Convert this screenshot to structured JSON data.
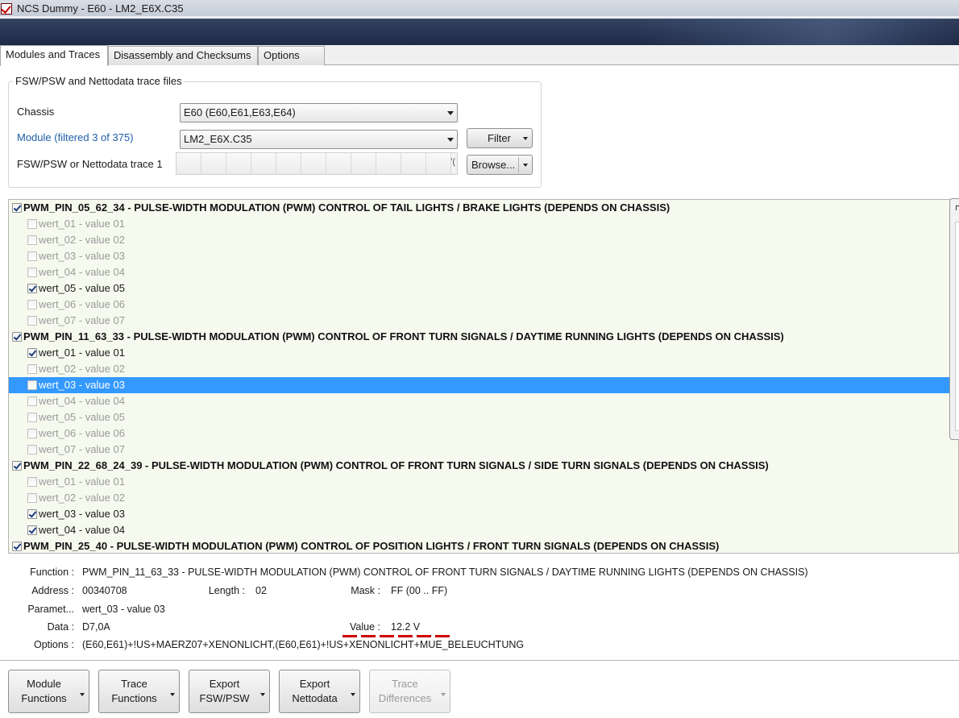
{
  "window": {
    "title": "NCS Dummy - E60 - LM2_E6X.C35"
  },
  "tabs": [
    {
      "label": "Modules and Traces",
      "active": true
    },
    {
      "label": "Disassembly and Checksums",
      "active": false
    },
    {
      "label": "Options",
      "active": false
    }
  ],
  "files": {
    "group_title": "FSW/PSW and Nettodata trace files",
    "chassis_label": "Chassis",
    "chassis_value": "E60  (E60,E61,E63,E64)",
    "module_label": "Module (filtered 3 of 375)",
    "module_value": "LM2_E6X.C35",
    "filter_button": "Filter",
    "trace_label": "FSW/PSW or Nettodata trace 1",
    "browse_button": "Browse...",
    "trace_tail_text": "'("
  },
  "tree": {
    "groups": [
      {
        "name": "PWM_PIN_05_62_34  -  PULSE-WIDTH MODULATION (PWM) CONTROL OF TAIL LIGHTS / BRAKE LIGHTS (DEPENDS ON CHASSIS)",
        "checked": true,
        "items": [
          {
            "label": "wert_01  -  value 01",
            "checked": false
          },
          {
            "label": "wert_02  -  value 02",
            "checked": false
          },
          {
            "label": "wert_03  -  value 03",
            "checked": false
          },
          {
            "label": "wert_04  -  value 04",
            "checked": false
          },
          {
            "label": "wert_05  -  value 05",
            "checked": true
          },
          {
            "label": "wert_06  -  value 06",
            "checked": false
          },
          {
            "label": "wert_07  -  value 07",
            "checked": false
          }
        ]
      },
      {
        "name": "PWM_PIN_11_63_33  -  PULSE-WIDTH MODULATION (PWM) CONTROL OF FRONT TURN SIGNALS / DAYTIME RUNNING LIGHTS (DEPENDS ON CHASSIS)",
        "checked": true,
        "items": [
          {
            "label": "wert_01  -  value 01",
            "checked": true
          },
          {
            "label": "wert_02  -  value 02",
            "checked": false
          },
          {
            "label": "wert_03  -  value 03",
            "checked": false,
            "selected": true
          },
          {
            "label": "wert_04  -  value 04",
            "checked": false
          },
          {
            "label": "wert_05  -  value 05",
            "checked": false
          },
          {
            "label": "wert_06  -  value 06",
            "checked": false
          },
          {
            "label": "wert_07  -  value 07",
            "checked": false
          }
        ]
      },
      {
        "name": "PWM_PIN_22_68_24_39  -  PULSE-WIDTH MODULATION (PWM) CONTROL OF FRONT TURN SIGNALS / SIDE TURN SIGNALS (DEPENDS ON CHASSIS)",
        "checked": true,
        "items": [
          {
            "label": "wert_01  -  value 01",
            "checked": false
          },
          {
            "label": "wert_02  -  value 02",
            "checked": false
          },
          {
            "label": "wert_03  -  value 03",
            "checked": true
          },
          {
            "label": "wert_04  -  value 04",
            "checked": true
          }
        ]
      },
      {
        "name": "PWM_PIN_25_40  -  PULSE-WIDTH MODULATION (PWM) CONTROL OF POSITION LIGHTS / FRONT TURN SIGNALS (DEPENDS ON CHASSIS)",
        "checked": true,
        "items": []
      }
    ]
  },
  "details": {
    "function_label": "Function :",
    "function_value": "PWM_PIN_11_63_33  -  PULSE-WIDTH MODULATION (PWM) CONTROL OF FRONT TURN SIGNALS / DAYTIME RUNNING LIGHTS (DEPENDS ON CHASSIS)",
    "address_label": "Address :",
    "address_value": "00340708",
    "length_label": "Length :",
    "length_value": "02",
    "mask_label": "Mask :",
    "mask_value": "FF  (00 .. FF)",
    "param_label": "Paramet...",
    "param_value": "wert_03  -  value 03",
    "data_label": "Data :",
    "data_value": "D7,0A",
    "value_label": "Value :",
    "value_value": "12.2 V",
    "options_label": "Options :",
    "options_value": "(E60,E61)+!US+MAERZ07+XENONLICHT,(E60,E61)+!US+XENONLICHT+MUE_BELEUCHTUNG"
  },
  "buttons": [
    {
      "line1": "Module",
      "line2": "Functions",
      "enabled": true
    },
    {
      "line1": "Trace",
      "line2": "Functions",
      "enabled": true
    },
    {
      "line1": "Export",
      "line2": "FSW/PSW",
      "enabled": true
    },
    {
      "line1": "Export",
      "line2": "Nettodata",
      "enabled": true
    },
    {
      "line1": "Trace",
      "line2": "Differences",
      "enabled": false
    }
  ],
  "colors": {
    "selection": "#3399ff",
    "tree_background": "#f6faee",
    "link_label": "#1f5ea8",
    "value_underline": "#d00000"
  }
}
